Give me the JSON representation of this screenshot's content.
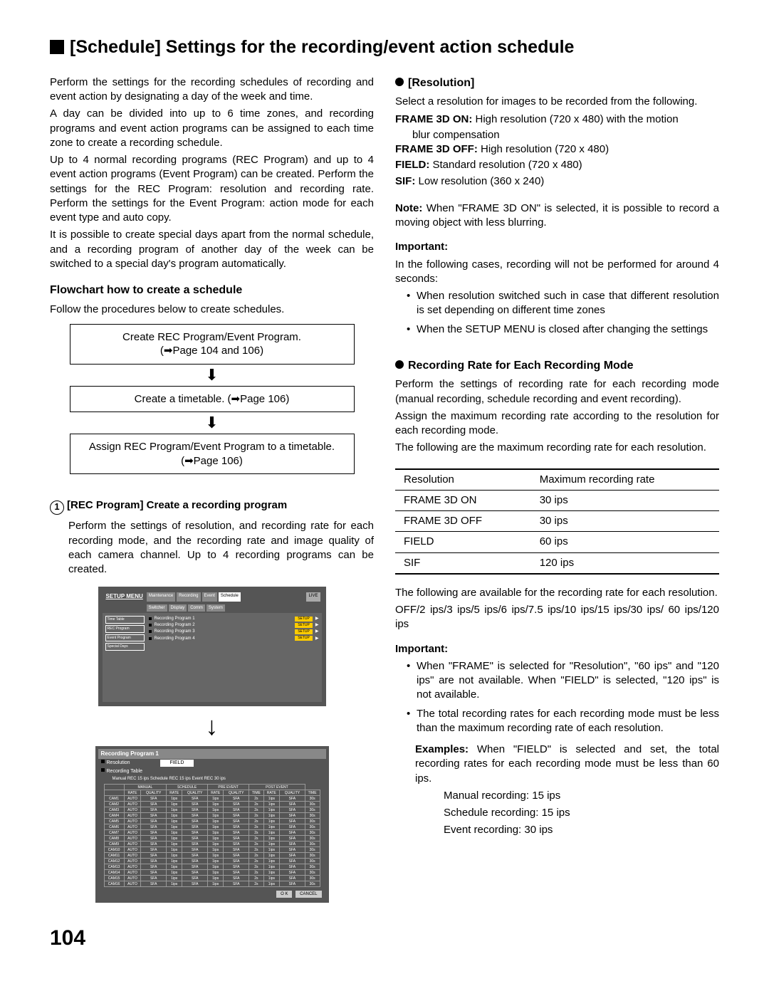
{
  "title": "[Schedule] Settings for the recording/event action schedule",
  "left": {
    "intro1": "Perform the settings for the recording schedules of recording and event action by designating a day of the week and time.",
    "intro2": "A day can be divided into up to 6 time zones, and recording programs and event action programs can be assigned to each time zone to create a recording schedule.",
    "intro3": "Up to 4 normal recording programs (REC Program) and up to 4 event action programs (Event Program) can be created. Perform the settings for the REC Program: resolution and recording rate. Perform the settings for the Event Program: action mode for each event type and auto copy.",
    "intro4": "It is possible to create special days apart from the normal schedule, and a recording program of another day of the week can be switched to a special day's program automatically.",
    "flowchart_title": "Flowchart how to create a schedule",
    "flowchart_intro": "Follow the procedures below to create schedules.",
    "flow_box1_l1": "Create REC Program/Event Program.",
    "flow_box1_l2": "(➡Page 104 and 106)",
    "flow_box2": "Create a timetable. (➡Page 106)",
    "flow_box3_l1": "Assign REC Program/Event Program to a timetable.",
    "flow_box3_l2": "(➡Page 106)",
    "step1_num": "1",
    "step1_title": "[REC Program] Create a recording program",
    "step1_text": "Perform the settings of resolution, and recording rate for each recording mode, and the recording rate and image quality of each camera channel. Up to 4 recording programs can be created.",
    "setup_menu": {
      "title": "SETUP MENU",
      "tabs": [
        "Maintenance",
        "Recording",
        "Event",
        "Schedule"
      ],
      "tabs2": [
        "Switcher",
        "Display",
        "Comm",
        "System"
      ],
      "live": "LIVE",
      "side": [
        "Time Table",
        "REC Program",
        "Event Program",
        "Special Days"
      ],
      "rows": [
        "Recording Program 1",
        "Recording Program 2",
        "Recording Program 3",
        "Recording Program 4"
      ],
      "setup_btn": "SETUP"
    },
    "rec_prog": {
      "title": "Recording Program 1",
      "res_label": "Resolution",
      "table_label": "Recording Table",
      "field": "FIELD",
      "rates": "Manual REC 15 ips  Schedule REC 15 ips  Event REC 30 ips",
      "ok": "O K",
      "cancel": "CANCEL"
    }
  },
  "right": {
    "resolution_title": "[Resolution]",
    "resolution_intro": "Select a resolution for images to be recorded from the following.",
    "defs": [
      {
        "label": "FRAME 3D ON:",
        "text": " High resolution (720 x 480) with the motion",
        "cont": "blur compensation"
      },
      {
        "label": "FRAME 3D OFF:",
        "text": " High resolution (720 x 480)"
      },
      {
        "label": "FIELD:",
        "text": " Standard resolution (720 x 480)"
      },
      {
        "label": "SIF:",
        "text": " Low resolution (360 x 240)"
      }
    ],
    "note_label": "Note:",
    "note_text": " When \"FRAME 3D ON\" is selected, it is possible to record a moving object with less blurring.",
    "important_label": "Important:",
    "important_intro": "In the following cases, recording will not be performed for around 4 seconds:",
    "imp_bullets": [
      "When resolution switched such in case that different resolution is set depending on different time zones",
      "When the SETUP MENU is closed after changing the settings"
    ],
    "rate_title": "Recording Rate for Each Recording Mode",
    "rate_p1": "Perform the settings of recording rate for each recording mode (manual recording, schedule recording and event recording).",
    "rate_p2": "Assign the maximum recording rate according to the resolution for each recording mode.",
    "rate_p3": "The following are the maximum recording rate for each resolution.",
    "table": {
      "h1": "Resolution",
      "h2": "Maximum recording rate",
      "rows": [
        [
          "FRAME 3D ON",
          "30 ips"
        ],
        [
          "FRAME 3D OFF",
          "30 ips"
        ],
        [
          "FIELD",
          "60 ips"
        ],
        [
          "SIF",
          "120 ips"
        ]
      ]
    },
    "after_table1": "The following are available for the recording rate for each resolution.",
    "after_table2": "OFF/2 ips/3 ips/5 ips/6 ips/7.5 ips/10 ips/15 ips/30 ips/ 60 ips/120 ips",
    "important2_label": "Important:",
    "imp2_bullets": [
      "When \"FRAME\" is selected for \"Resolution\", \"60 ips\" and \"120 ips\" are not available. When \"FIELD\" is selected, \"120 ips\" is not available.",
      "The total recording rates for each recording mode must be less than the maximum recording rate of each resolution."
    ],
    "examples_label": "Examples:",
    "examples_text": " When \"FIELD\" is selected and set, the total recording rates for each recording mode must be less than 60 ips.",
    "examples_lines": [
      "Manual recording: 15 ips",
      "Schedule recording: 15 ips",
      "Event recording: 30 ips"
    ]
  },
  "page_number": "104"
}
